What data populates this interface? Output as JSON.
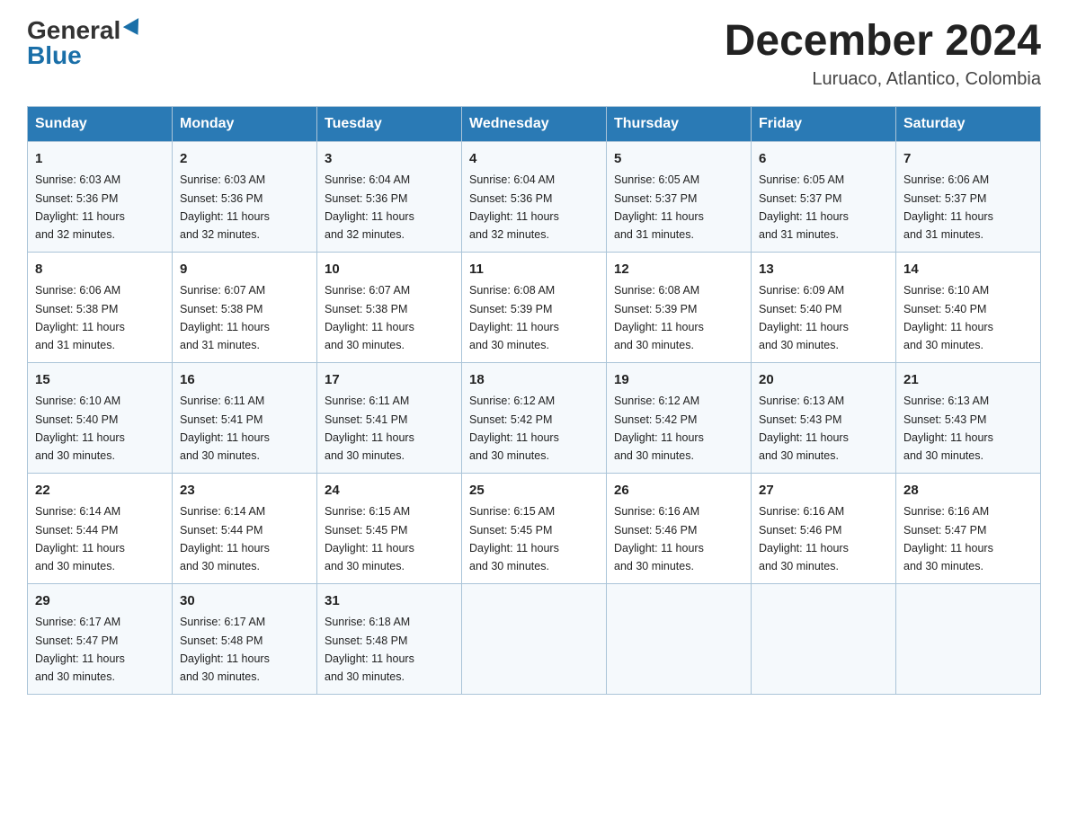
{
  "header": {
    "logo_general": "General",
    "logo_blue": "Blue",
    "month_title": "December 2024",
    "location": "Luruaco, Atlantico, Colombia"
  },
  "days_of_week": [
    "Sunday",
    "Monday",
    "Tuesday",
    "Wednesday",
    "Thursday",
    "Friday",
    "Saturday"
  ],
  "weeks": [
    [
      {
        "day": "1",
        "sunrise": "6:03 AM",
        "sunset": "5:36 PM",
        "daylight": "11 hours and 32 minutes."
      },
      {
        "day": "2",
        "sunrise": "6:03 AM",
        "sunset": "5:36 PM",
        "daylight": "11 hours and 32 minutes."
      },
      {
        "day": "3",
        "sunrise": "6:04 AM",
        "sunset": "5:36 PM",
        "daylight": "11 hours and 32 minutes."
      },
      {
        "day": "4",
        "sunrise": "6:04 AM",
        "sunset": "5:36 PM",
        "daylight": "11 hours and 32 minutes."
      },
      {
        "day": "5",
        "sunrise": "6:05 AM",
        "sunset": "5:37 PM",
        "daylight": "11 hours and 31 minutes."
      },
      {
        "day": "6",
        "sunrise": "6:05 AM",
        "sunset": "5:37 PM",
        "daylight": "11 hours and 31 minutes."
      },
      {
        "day": "7",
        "sunrise": "6:06 AM",
        "sunset": "5:37 PM",
        "daylight": "11 hours and 31 minutes."
      }
    ],
    [
      {
        "day": "8",
        "sunrise": "6:06 AM",
        "sunset": "5:38 PM",
        "daylight": "11 hours and 31 minutes."
      },
      {
        "day": "9",
        "sunrise": "6:07 AM",
        "sunset": "5:38 PM",
        "daylight": "11 hours and 31 minutes."
      },
      {
        "day": "10",
        "sunrise": "6:07 AM",
        "sunset": "5:38 PM",
        "daylight": "11 hours and 30 minutes."
      },
      {
        "day": "11",
        "sunrise": "6:08 AM",
        "sunset": "5:39 PM",
        "daylight": "11 hours and 30 minutes."
      },
      {
        "day": "12",
        "sunrise": "6:08 AM",
        "sunset": "5:39 PM",
        "daylight": "11 hours and 30 minutes."
      },
      {
        "day": "13",
        "sunrise": "6:09 AM",
        "sunset": "5:40 PM",
        "daylight": "11 hours and 30 minutes."
      },
      {
        "day": "14",
        "sunrise": "6:10 AM",
        "sunset": "5:40 PM",
        "daylight": "11 hours and 30 minutes."
      }
    ],
    [
      {
        "day": "15",
        "sunrise": "6:10 AM",
        "sunset": "5:40 PM",
        "daylight": "11 hours and 30 minutes."
      },
      {
        "day": "16",
        "sunrise": "6:11 AM",
        "sunset": "5:41 PM",
        "daylight": "11 hours and 30 minutes."
      },
      {
        "day": "17",
        "sunrise": "6:11 AM",
        "sunset": "5:41 PM",
        "daylight": "11 hours and 30 minutes."
      },
      {
        "day": "18",
        "sunrise": "6:12 AM",
        "sunset": "5:42 PM",
        "daylight": "11 hours and 30 minutes."
      },
      {
        "day": "19",
        "sunrise": "6:12 AM",
        "sunset": "5:42 PM",
        "daylight": "11 hours and 30 minutes."
      },
      {
        "day": "20",
        "sunrise": "6:13 AM",
        "sunset": "5:43 PM",
        "daylight": "11 hours and 30 minutes."
      },
      {
        "day": "21",
        "sunrise": "6:13 AM",
        "sunset": "5:43 PM",
        "daylight": "11 hours and 30 minutes."
      }
    ],
    [
      {
        "day": "22",
        "sunrise": "6:14 AM",
        "sunset": "5:44 PM",
        "daylight": "11 hours and 30 minutes."
      },
      {
        "day": "23",
        "sunrise": "6:14 AM",
        "sunset": "5:44 PM",
        "daylight": "11 hours and 30 minutes."
      },
      {
        "day": "24",
        "sunrise": "6:15 AM",
        "sunset": "5:45 PM",
        "daylight": "11 hours and 30 minutes."
      },
      {
        "day": "25",
        "sunrise": "6:15 AM",
        "sunset": "5:45 PM",
        "daylight": "11 hours and 30 minutes."
      },
      {
        "day": "26",
        "sunrise": "6:16 AM",
        "sunset": "5:46 PM",
        "daylight": "11 hours and 30 minutes."
      },
      {
        "day": "27",
        "sunrise": "6:16 AM",
        "sunset": "5:46 PM",
        "daylight": "11 hours and 30 minutes."
      },
      {
        "day": "28",
        "sunrise": "6:16 AM",
        "sunset": "5:47 PM",
        "daylight": "11 hours and 30 minutes."
      }
    ],
    [
      {
        "day": "29",
        "sunrise": "6:17 AM",
        "sunset": "5:47 PM",
        "daylight": "11 hours and 30 minutes."
      },
      {
        "day": "30",
        "sunrise": "6:17 AM",
        "sunset": "5:48 PM",
        "daylight": "11 hours and 30 minutes."
      },
      {
        "day": "31",
        "sunrise": "6:18 AM",
        "sunset": "5:48 PM",
        "daylight": "11 hours and 30 minutes."
      },
      null,
      null,
      null,
      null
    ]
  ],
  "labels": {
    "sunrise_prefix": "Sunrise: ",
    "sunset_prefix": "Sunset: ",
    "daylight_prefix": "Daylight: "
  }
}
